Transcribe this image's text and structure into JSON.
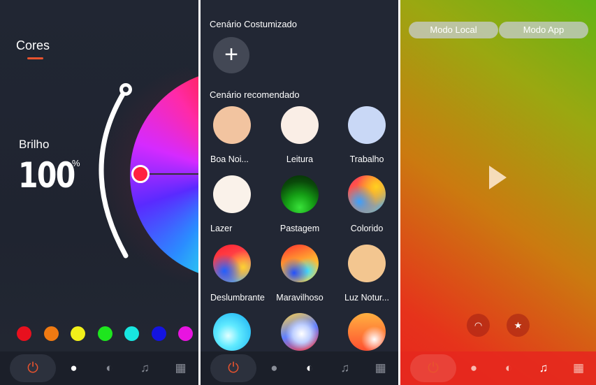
{
  "panel1": {
    "title": "Cores",
    "brightness_label": "Brilho",
    "brightness_value": "100",
    "brightness_unit": "%",
    "brightness_level": 1.0,
    "swatches": [
      "#e8101e",
      "#f07a12",
      "#f2f01a",
      "#1ee61e",
      "#18e6e0",
      "#1414e0",
      "#e814e0"
    ],
    "accent": "#e8532e"
  },
  "panel2": {
    "custom_heading": "Cenário Costumizado",
    "add_symbol": "+",
    "recommended_heading": "Cenário recomendado",
    "scenes": [
      {
        "label": "Boa Noi...",
        "color": "#f2c4a0"
      },
      {
        "label": "Leitura",
        "color": "#faeee6"
      },
      {
        "label": "Trabalho",
        "color": "#c9d8f6"
      },
      {
        "label": "Lazer",
        "color": "#faf2ea"
      },
      {
        "label": "Pastagem",
        "color": "#1aa51a"
      },
      {
        "label": "Colorido",
        "color": "#f07050"
      },
      {
        "label": "Deslumbrante",
        "color": "#e84040"
      },
      {
        "label": "Maravilhoso",
        "color": "#f0b030"
      },
      {
        "label": "Luz Notur...",
        "color": "#f3c690"
      }
    ]
  },
  "panel3": {
    "mode_local": "Modo Local",
    "mode_app": "Modo App"
  },
  "nav": {
    "icons": [
      "power-icon",
      "bulb-icon",
      "palette-icon",
      "music-icon",
      "grid-icon"
    ]
  }
}
